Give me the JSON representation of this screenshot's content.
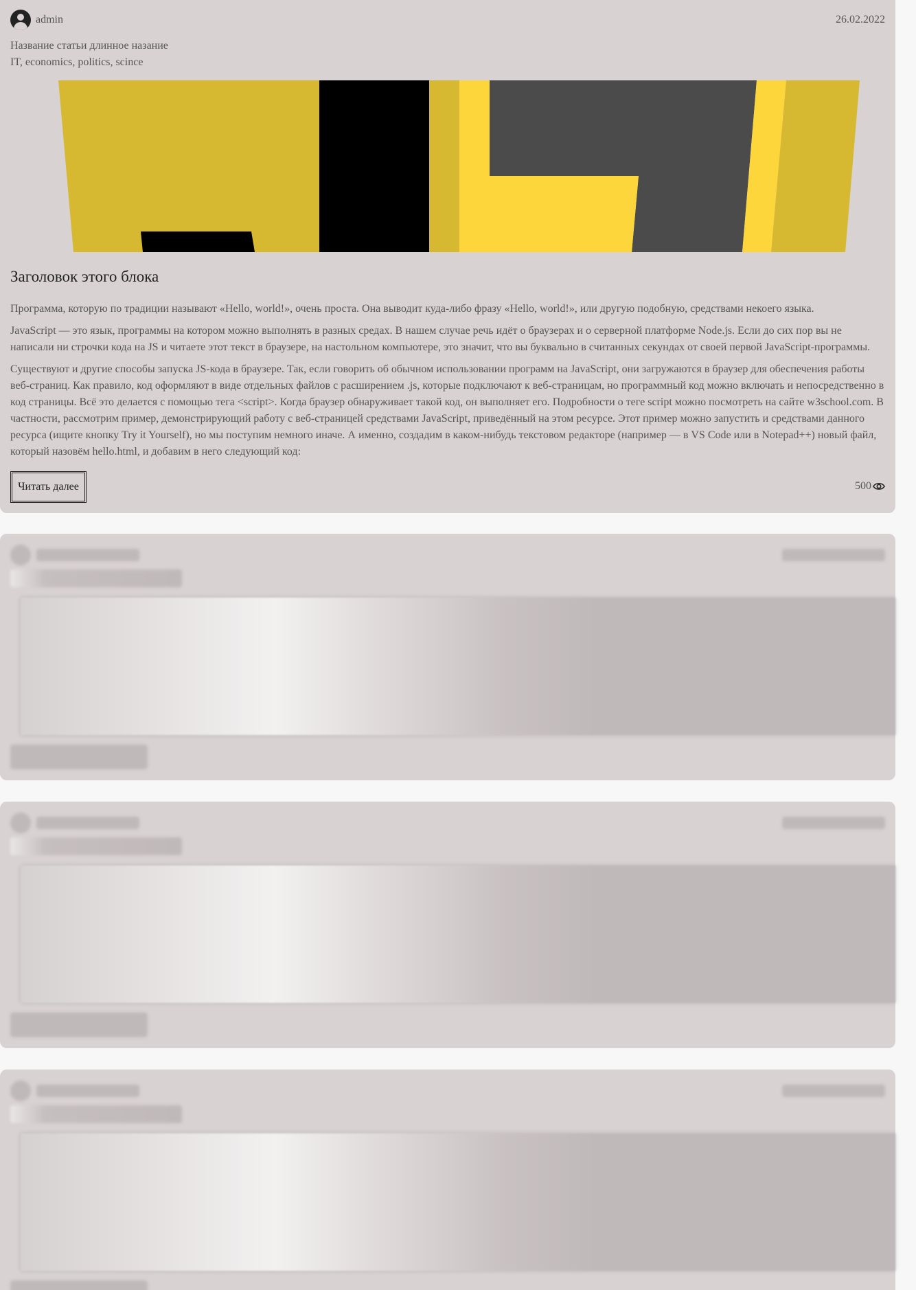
{
  "article": {
    "author": "admin",
    "date": "26.02.2022",
    "subtitle": "Название статьи длинное назание",
    "tags": "IT, economics, politics, scince",
    "block_title": "Заголовок этого блока",
    "paragraphs": [
      "Программа, которую по традиции называют «Hello, world!», очень проста. Она выводит куда-либо фразу «Hello, world!», или другую подобную, средствами некоего языка.",
      "JavaScript — это язык, программы на котором можно выполнять в разных средах. В нашем случае речь идёт о браузерах и о серверной платформе Node.js. Если до сих пор вы не написали ни строчки кода на JS и читаете этот текст в браузере, на настольном компьютере, это значит, что вы буквально в считанных секундах от своей первой JavaScript-программы.",
      "Существуют и другие способы запуска JS-кода в браузере. Так, если говорить об обычном использовании программ на JavaScript, они загружаются в браузер для обеспечения работы веб-страниц. Как правило, код оформляют в виде отдельных файлов с расширением .js, которые подключают к веб-страницам, но программный код можно включать и непосредственно в код страницы. Всё это делается с помощью тега <script>. Когда браузер обнаруживает такой код, он выполняет его. Подробности о теге script можно посмотреть на сайте w3school.com. В частности, рассмотрим пример, демонстрирующий работу с веб-страницей средствами JavaScript, приведённый на этом ресурсе. Этот пример можно запустить и средствами данного ресурса (ищите кнопку Try it Yourself), но мы поступим немного иначе. А именно, создадим в каком-нибудь текстовом редакторе (например — в VS Code или в Notepad++) новый файл, который назовём hello.html, и добавим в него следующий код:"
    ],
    "read_more_label": "Читать далее",
    "views": "500",
    "icons": {
      "avatar": "user-avatar-icon",
      "views": "eye-icon"
    },
    "banner_colors": {
      "yellow": "#d6b931",
      "bright_yellow": "#fdd63c",
      "black": "#000000",
      "gray": "#4b4b4b"
    }
  },
  "skeleton_cards": 3
}
